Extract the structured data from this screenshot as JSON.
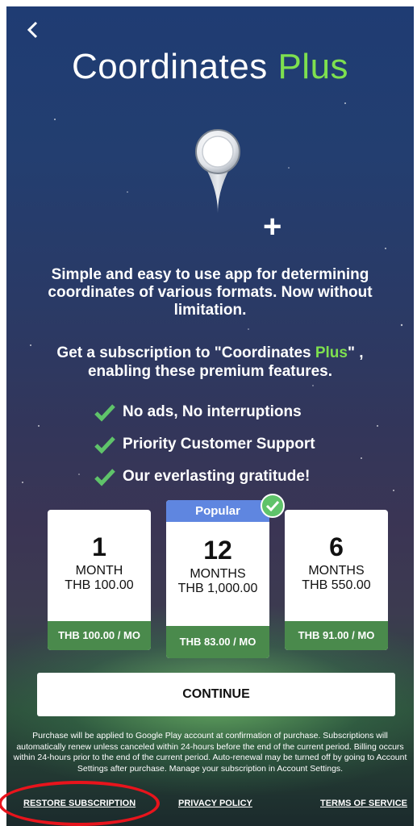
{
  "header": {
    "back_icon": "chevron-left-icon",
    "title_main": "Coordinates",
    "title_accent": "Plus"
  },
  "colors": {
    "accent_green": "#7ee04f",
    "popular_blue": "#5f86e0",
    "per_month_green": "#4a8a4c",
    "highlight_red": "#e8141c"
  },
  "description": "Simple and easy to use app for determining coordinates of various formats. Now without limitation.",
  "subscription_prompt": {
    "before": "Get a subscription to \"Coordinates ",
    "accent": "Plus",
    "after": "\" , enabling these premium features."
  },
  "features": [
    "No ads, No interruptions",
    "Priority Customer Support",
    "Our everlasting gratitude!"
  ],
  "plans": [
    {
      "count": "1",
      "unit": "MONTH",
      "price": "THB 100.00",
      "per_month": "THB 100.00 / MO"
    },
    {
      "badge": "Popular",
      "count": "12",
      "unit": "MONTHS",
      "price": "THB 1,000.00",
      "per_month": "THB 83.00 / MO",
      "selected": true
    },
    {
      "count": "6",
      "unit": "MONTHS",
      "price": "THB 550.00",
      "per_month": "THB 91.00 / MO"
    }
  ],
  "continue_label": "CONTINUE",
  "legal_text": "Purchase will be applied to Google Play account at confirmation of purchase. Subscriptions will automatically renew unless canceled within 24-hours before the end of the current period. Billing occurs within 24-hours prior to the end of the current period. Auto-renewal may be turned off by going to Account Settings after purchase. Manage your subscription in Account Settings.",
  "footer": {
    "restore": "RESTORE SUBSCRIPTION",
    "privacy": "PRIVACY POLICY",
    "terms": "TERMS OF SERVICE"
  }
}
